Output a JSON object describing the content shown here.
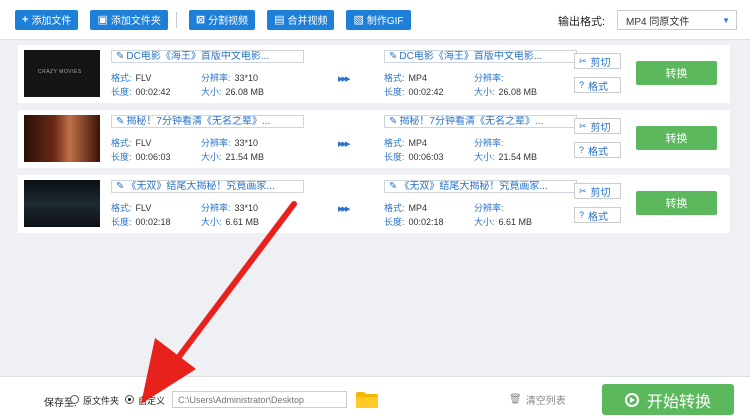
{
  "toolbar": {
    "add_file": "添加文件",
    "add_folder": "添加文件夹",
    "split_video": "分割视频",
    "merge_video": "合并视频",
    "make_gif": "制作GIF",
    "output_format_label": "输出格式:",
    "output_format_value": "MP4 同原文件"
  },
  "labels": {
    "format": "格式:",
    "resolution": "分辨率:",
    "duration": "长度:",
    "size": "大小:",
    "cut": "剪切",
    "fmt_btn": "格式",
    "convert": "转换"
  },
  "files": [
    {
      "src": {
        "title": "DC电影《海王》首版中文电影...",
        "format": "FLV",
        "resolution": "33*10",
        "duration": "00:02:42",
        "size": "26.08 MB"
      },
      "dst": {
        "title": "DC电影《海王》首版中文电影...",
        "format": "MP4",
        "resolution": "",
        "duration": "00:02:42",
        "size": "26.08 MB"
      }
    },
    {
      "src": {
        "title": "揭秘！7分钟看清《无名之辈》...",
        "format": "FLV",
        "resolution": "33*10",
        "duration": "00:06:03",
        "size": "21.54 MB"
      },
      "dst": {
        "title": "揭秘！7分钟看清《无名之辈》...",
        "format": "MP4",
        "resolution": "",
        "duration": "00:06:03",
        "size": "21.54 MB"
      }
    },
    {
      "src": {
        "title": "《无双》结尾大揭秘！究竟画家...",
        "format": "FLV",
        "resolution": "33*10",
        "duration": "00:02:18",
        "size": "6.61 MB"
      },
      "dst": {
        "title": "《无双》结尾大揭秘！究竟画家...",
        "format": "MP4",
        "resolution": "",
        "duration": "00:02:18",
        "size": "6.61 MB"
      }
    }
  ],
  "bottom": {
    "save_to_label": "保存至:",
    "option_source": "原文件夹",
    "option_custom": "自定义",
    "selected_option": "custom",
    "path_placeholder": "C:\\Users\\Administrator\\Desktop",
    "clear_list": "清空列表",
    "start_convert": "开始转换"
  },
  "colors": {
    "accent_blue": "#1e7fd8",
    "convert_green": "#5cb85c",
    "annotation_red": "#e8211c"
  }
}
